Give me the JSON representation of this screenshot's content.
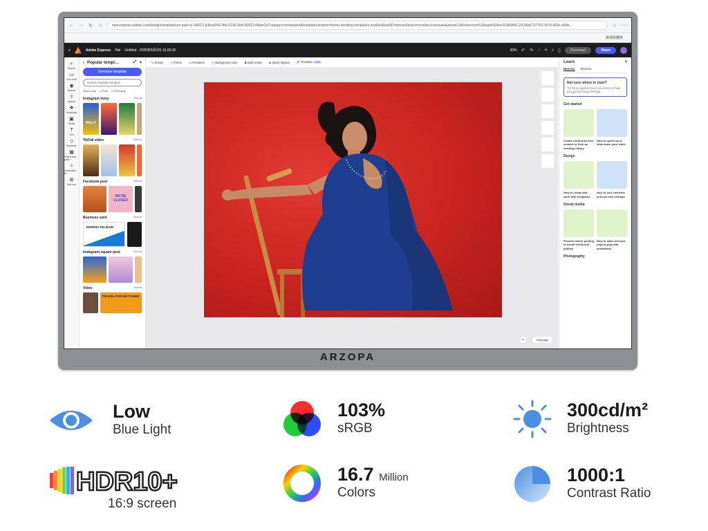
{
  "browser": {
    "url": "new.express.adobe.com/design/template/urn:aaid:sc:VA6C2:a3bcd249-2ffa-5136-8cfe-80627e8eee2a?category=templates&templateLocation=home-trending-templates-module&taskID=poster&learn=creative-exercises&assetCollection=urn%3Aaaid%3Asc%3AVA6C2%3Aa6707752-9c76-493e-a09e...",
    "secondary_label": "其他收藏夹"
  },
  "app": {
    "name": "Adobe Express",
    "file_menu": "File",
    "doc_title": "Untitled - 2025年6月3日 15.00.42",
    "zoom": "30%",
    "download": "Download",
    "share": "Share"
  },
  "rail": [
    "Search",
    "Your stuff",
    "Brands",
    "Upload",
    "Templates",
    "Media",
    "Text",
    "Elements",
    "Charts and grids",
    "Generative AI",
    "Add-ons"
  ],
  "panel": {
    "title": "Popular templ…",
    "generate": "Generate template",
    "search_placeholder": "Search Popular templat...",
    "show_only": "Show only",
    "free": "Free",
    "premium": "Premium",
    "view_all": "View all",
    "sections": [
      "Instagram story",
      "TikTok video",
      "Facebook post",
      "Business card",
      "Instagram square post",
      "Video"
    ],
    "bc_name": "MORRIS TELMAIN",
    "story_text": "WILLY",
    "fb_text": "WE'RE CLOSED",
    "video_text": "TRAVEL FOR WATCHING"
  },
  "toolbar": [
    "Resize",
    "Theme",
    "Animation",
    "Background color",
    "Bulk create",
    "Quick replace",
    "Translate"
  ],
  "toolbar_new": "NEW",
  "canvas": {
    "add_page": "Add page",
    "more": "•••"
  },
  "learn": {
    "title": "Learn",
    "tab_howtos": "How-tos",
    "tab_discover": "Discover",
    "not_sure_title": "Not sure where to start?",
    "not_sure_body": "Try these guided how-to exercises to help you get the hang of things.",
    "get_started": "Get started",
    "gs1": "Create a brand kit from scratch or from an existing Library",
    "gs2": "How to speed up or slow down your video",
    "design": "Design",
    "d1": "How to create and work with templates",
    "d2": "How to lock elements and use lock settings",
    "social": "Social media",
    "s1": "Preview before posting to social media and publish",
    "s2": "How to make text and objects pop with animations",
    "photography": "Photography"
  },
  "bezel_brand": "ARZOPA",
  "features": {
    "low_title": "Low",
    "low_sub": "Blue Light",
    "srgb_title": "103%",
    "srgb_sub": "sRGB",
    "bright_title": "300cd/m²",
    "bright_sub": "Brightness",
    "hdr_logo": "HDR10+",
    "hdr_sub": "16:9 screen",
    "colors_title": "16.7",
    "colors_unit": "Million",
    "colors_sub": "Colors",
    "contrast_title": "1000:1",
    "contrast_sub": "Contrast Ratio"
  },
  "icons": {
    "eye": "eye-icon",
    "rgb": "rgb-circles-icon",
    "sun": "sun-icon",
    "color_wheel": "color-wheel-icon",
    "contrast": "contrast-circle-icon"
  },
  "colors": {
    "accent_blue": "#4b8fe0",
    "share_button": "#4b5cf6",
    "photo_background": "#c8231f",
    "dress": "#1e3f8f"
  }
}
